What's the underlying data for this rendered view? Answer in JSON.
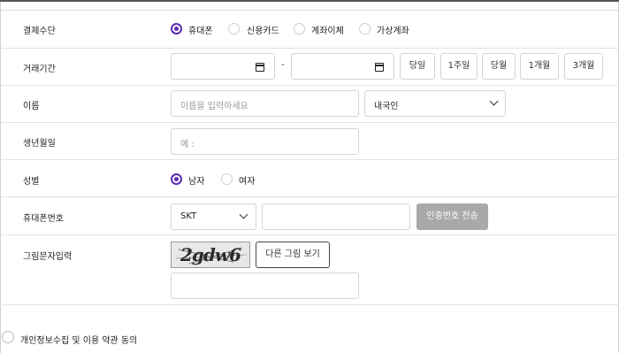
{
  "payment": {
    "label": "결제수단",
    "options": [
      {
        "label": "휴대폰",
        "selected": true
      },
      {
        "label": "신용카드",
        "selected": false
      },
      {
        "label": "계좌이체",
        "selected": false
      },
      {
        "label": "가상계좌",
        "selected": false
      }
    ]
  },
  "period": {
    "label": "거래기간",
    "separator": "-",
    "buttons": [
      "당일",
      "1주일",
      "당월",
      "1개월",
      "3개월"
    ]
  },
  "name": {
    "label": "이름",
    "placeholder": "이름을 입력하세요",
    "nationality": "내국인"
  },
  "birth": {
    "label": "생년월일",
    "placeholder": "예 :"
  },
  "gender": {
    "label": "성별",
    "options": [
      {
        "label": "남자",
        "selected": true
      },
      {
        "label": "여자",
        "selected": false
      }
    ]
  },
  "phone": {
    "label": "휴대폰번호",
    "carrier": "SKT",
    "send_button": "인증번호 전송"
  },
  "captcha": {
    "label": "그림문자입력",
    "image_text": "2gdw6",
    "refresh_button": "다른 그림 보기"
  },
  "agree": {
    "label": "개인정보수집 및 이용 약관 동의"
  },
  "colors": {
    "accent": "#5b2db3",
    "disabled_button": "#a9a9a9"
  }
}
